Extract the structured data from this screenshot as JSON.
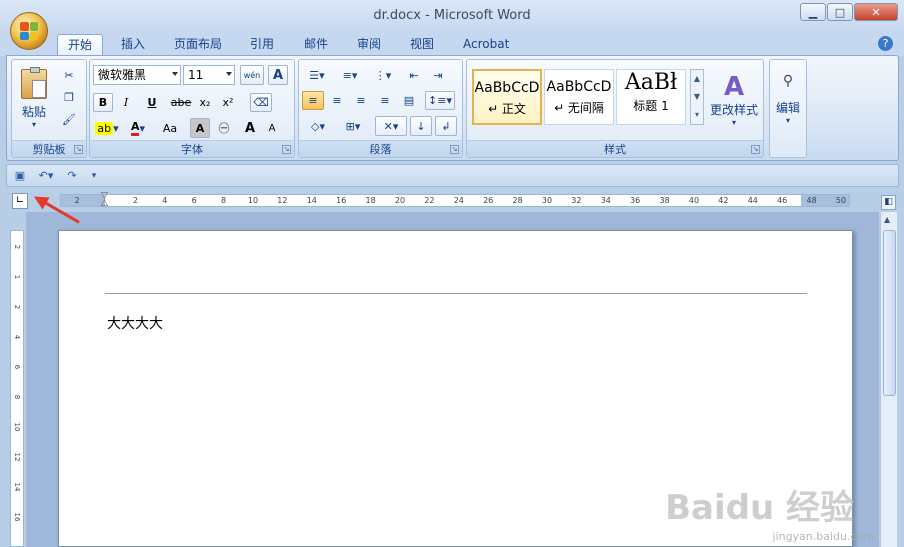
{
  "window": {
    "title": "dr.docx - Microsoft Word"
  },
  "tabs": [
    "开始",
    "插入",
    "页面布局",
    "引用",
    "邮件",
    "审阅",
    "视图",
    "Acrobat"
  ],
  "clipboard": {
    "paste_label": "粘贴",
    "group_label": "剪贴板"
  },
  "font": {
    "name": "微软雅黑",
    "size": "11",
    "group_label": "字体",
    "buttons": {
      "bold": "B",
      "italic": "I",
      "underline": "U",
      "strike": "abe",
      "sub": "x₂",
      "sup": "x²",
      "grow": "A",
      "shrink": "A",
      "case": "Aa",
      "clear": "A"
    }
  },
  "paragraph": {
    "group_label": "段落"
  },
  "styles": {
    "group_label": "样式",
    "change_label": "更改样式",
    "items": [
      {
        "preview": "AaBbCcD",
        "name": "↵ 正文"
      },
      {
        "preview": "AaBbCcD",
        "name": "↵ 无间隔"
      },
      {
        "preview": "AaBł",
        "name": "标题 1"
      }
    ]
  },
  "editing": {
    "label": "编辑"
  },
  "ruler": {
    "ticks": [
      "2",
      "2",
      "4",
      "6",
      "8",
      "10",
      "12",
      "14",
      "16",
      "18",
      "20",
      "22",
      "24",
      "26",
      "28",
      "30",
      "32",
      "34",
      "36",
      "38",
      "40",
      "42",
      "44",
      "46",
      "48",
      "50"
    ]
  },
  "vruler": {
    "ticks": [
      "2",
      "1",
      "2",
      "4",
      "6",
      "8",
      "10",
      "12",
      "14",
      "16"
    ]
  },
  "document": {
    "text": "大大大大"
  },
  "watermark": {
    "logo": "Baidu 经验",
    "url": "jingyan.baidu.com"
  },
  "colors": {
    "accent": "#15428b",
    "arrow": "#e23b2e"
  }
}
